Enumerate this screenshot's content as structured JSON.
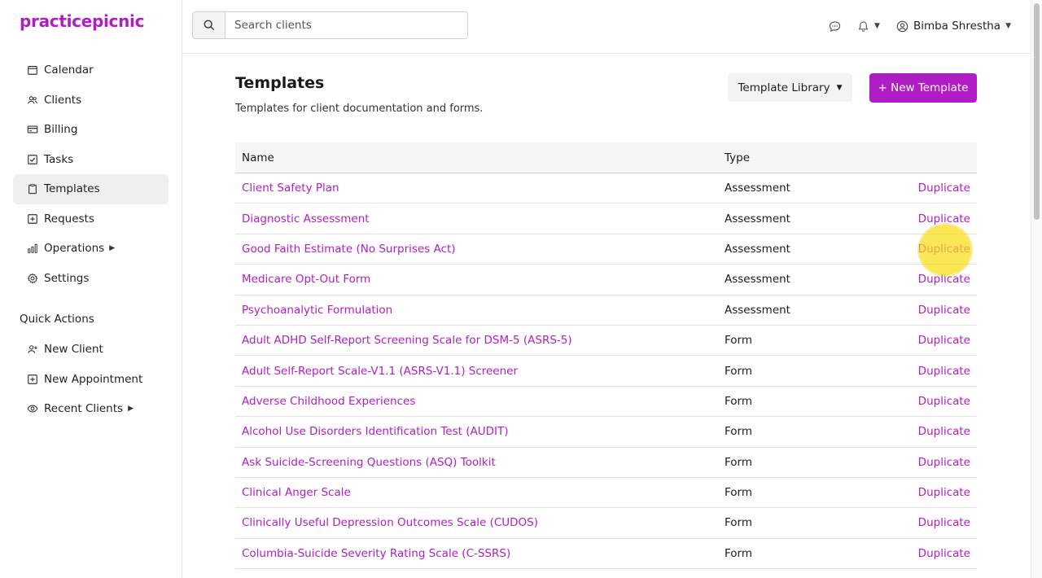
{
  "brand": "practicepicnic",
  "colors": {
    "accent": "#b01dc4",
    "highlight": "#f5d21a"
  },
  "sidebar": {
    "items": [
      {
        "label": "Calendar",
        "icon": "calendar-icon"
      },
      {
        "label": "Clients",
        "icon": "users-icon"
      },
      {
        "label": "Billing",
        "icon": "credit-card-icon"
      },
      {
        "label": "Tasks",
        "icon": "checkbox-icon"
      },
      {
        "label": "Templates",
        "icon": "clipboard-icon",
        "active": true
      },
      {
        "label": "Requests",
        "icon": "plus-square-icon"
      },
      {
        "label": "Operations",
        "icon": "bar-chart-icon",
        "caret": true
      },
      {
        "label": "Settings",
        "icon": "gear-icon"
      }
    ],
    "quick_actions_title": "Quick Actions",
    "quick_actions": [
      {
        "label": "New Client",
        "icon": "add-user-icon"
      },
      {
        "label": "New Appointment",
        "icon": "plus-square-icon"
      },
      {
        "label": "Recent Clients",
        "icon": "eye-icon",
        "caret": true
      }
    ]
  },
  "search": {
    "placeholder": "Search clients"
  },
  "header": {
    "user_name": "Bimba Shrestha"
  },
  "page": {
    "title": "Templates",
    "subtitle": "Templates for client documentation and forms.",
    "library_button": "Template Library",
    "new_button": "+ New Template"
  },
  "table": {
    "headers": {
      "name": "Name",
      "type": "Type"
    },
    "action_label": "Duplicate",
    "rows": [
      {
        "name": "Client Safety Plan",
        "type": "Assessment"
      },
      {
        "name": "Diagnostic Assessment",
        "type": "Assessment"
      },
      {
        "name": "Good Faith Estimate (No Surprises Act)",
        "type": "Assessment"
      },
      {
        "name": "Medicare Opt-Out Form",
        "type": "Assessment"
      },
      {
        "name": "Psychoanalytic Formulation",
        "type": "Assessment"
      },
      {
        "name": "Adult ADHD Self-Report Screening Scale for DSM-5 (ASRS-5)",
        "type": "Form"
      },
      {
        "name": "Adult Self-Report Scale-V1.1 (ASRS-V1.1) Screener",
        "type": "Form"
      },
      {
        "name": "Adverse Childhood Experiences",
        "type": "Form"
      },
      {
        "name": "Alcohol Use Disorders Identification Test (AUDIT)",
        "type": "Form"
      },
      {
        "name": "Ask Suicide-Screening Questions (ASQ) Toolkit",
        "type": "Form"
      },
      {
        "name": "Clinical Anger Scale",
        "type": "Form"
      },
      {
        "name": "Clinically Useful Depression Outcomes Scale (CUDOS)",
        "type": "Form"
      },
      {
        "name": "Columbia-Suicide Severity Rating Scale (C-SSRS)",
        "type": "Form"
      }
    ]
  }
}
